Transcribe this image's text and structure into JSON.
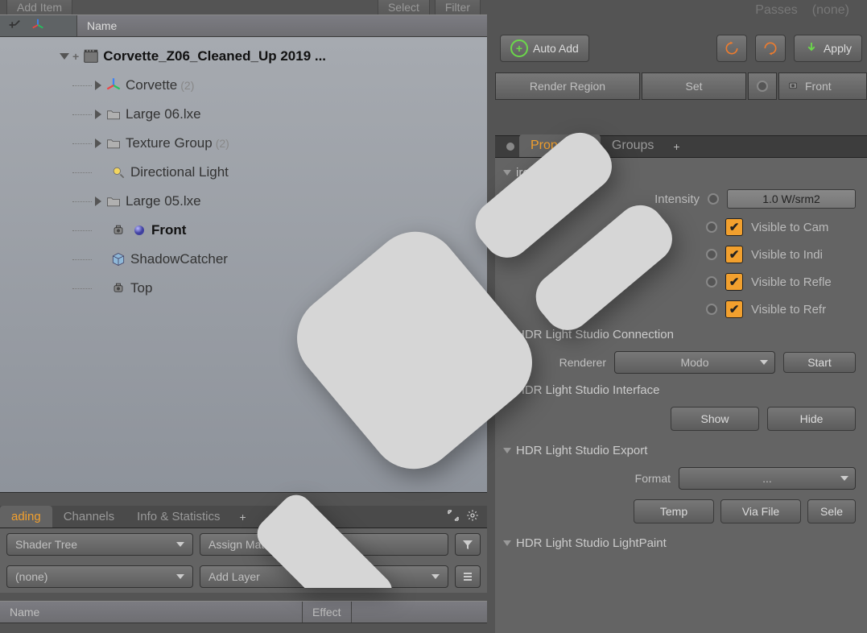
{
  "top_left": {
    "add_item": "Add Item",
    "select": "Select",
    "filter": "Filter"
  },
  "hierarchy": {
    "header": "Name",
    "root": {
      "label": "Corvette_Z06_Cleaned_Up 2019 ..."
    },
    "items": [
      {
        "label": "Corvette",
        "count": "(2)",
        "icon": "axis"
      },
      {
        "label": "Large 06.lxe",
        "icon": "folder"
      },
      {
        "label": "Texture Group",
        "count": "(2)",
        "icon": "folder"
      },
      {
        "label": "Directional Light",
        "icon": "light"
      },
      {
        "label": "Large 05.lxe",
        "icon": "folder"
      },
      {
        "label": "Front",
        "bold": true,
        "icon": "camera-env"
      },
      {
        "label": "ShadowCatcher",
        "icon": "cube"
      },
      {
        "label": "Top",
        "icon": "camera"
      }
    ]
  },
  "bottom_tabs": {
    "shading": "ading",
    "channels": "Channels",
    "info": "Info & Statistics"
  },
  "shader": {
    "tree": "Shader Tree",
    "none": "(none)",
    "assign": "Assign Material",
    "add_layer": "Add Layer",
    "col_name": "Name",
    "col_effect": "Effect"
  },
  "rtop": {
    "passes": "Passes",
    "none": "(none)"
  },
  "toolbar": {
    "auto_add": "Auto Add",
    "apply": "Apply"
  },
  "render_region": {
    "label": "Render Region",
    "set": "Set",
    "front": "Front"
  },
  "tabs": {
    "properties": "Properties",
    "groups": "Groups"
  },
  "env": {
    "header": "ironment",
    "intensity_label": "Intensity",
    "intensity_value": "1.0 W/srm2",
    "vis_cam": "Visible to Cam",
    "vis_ind": "Visible to Indi",
    "vis_refl": "Visible to Refle",
    "vis_refr": "Visible to Refr"
  },
  "hdr_conn": {
    "header": "HDR Light Studio Connection",
    "renderer": "Renderer",
    "modo": "Modo",
    "start": "Start"
  },
  "hdr_iface": {
    "header": "HDR Light Studio Interface",
    "show": "Show",
    "hide": "Hide"
  },
  "hdr_export": {
    "header": "HDR Light Studio Export",
    "format": "Format",
    "format_val": "...",
    "temp": "Temp",
    "via_file": "Via File",
    "sele": "Sele"
  },
  "hdr_lp": {
    "header": "HDR Light Studio LightPaint"
  }
}
